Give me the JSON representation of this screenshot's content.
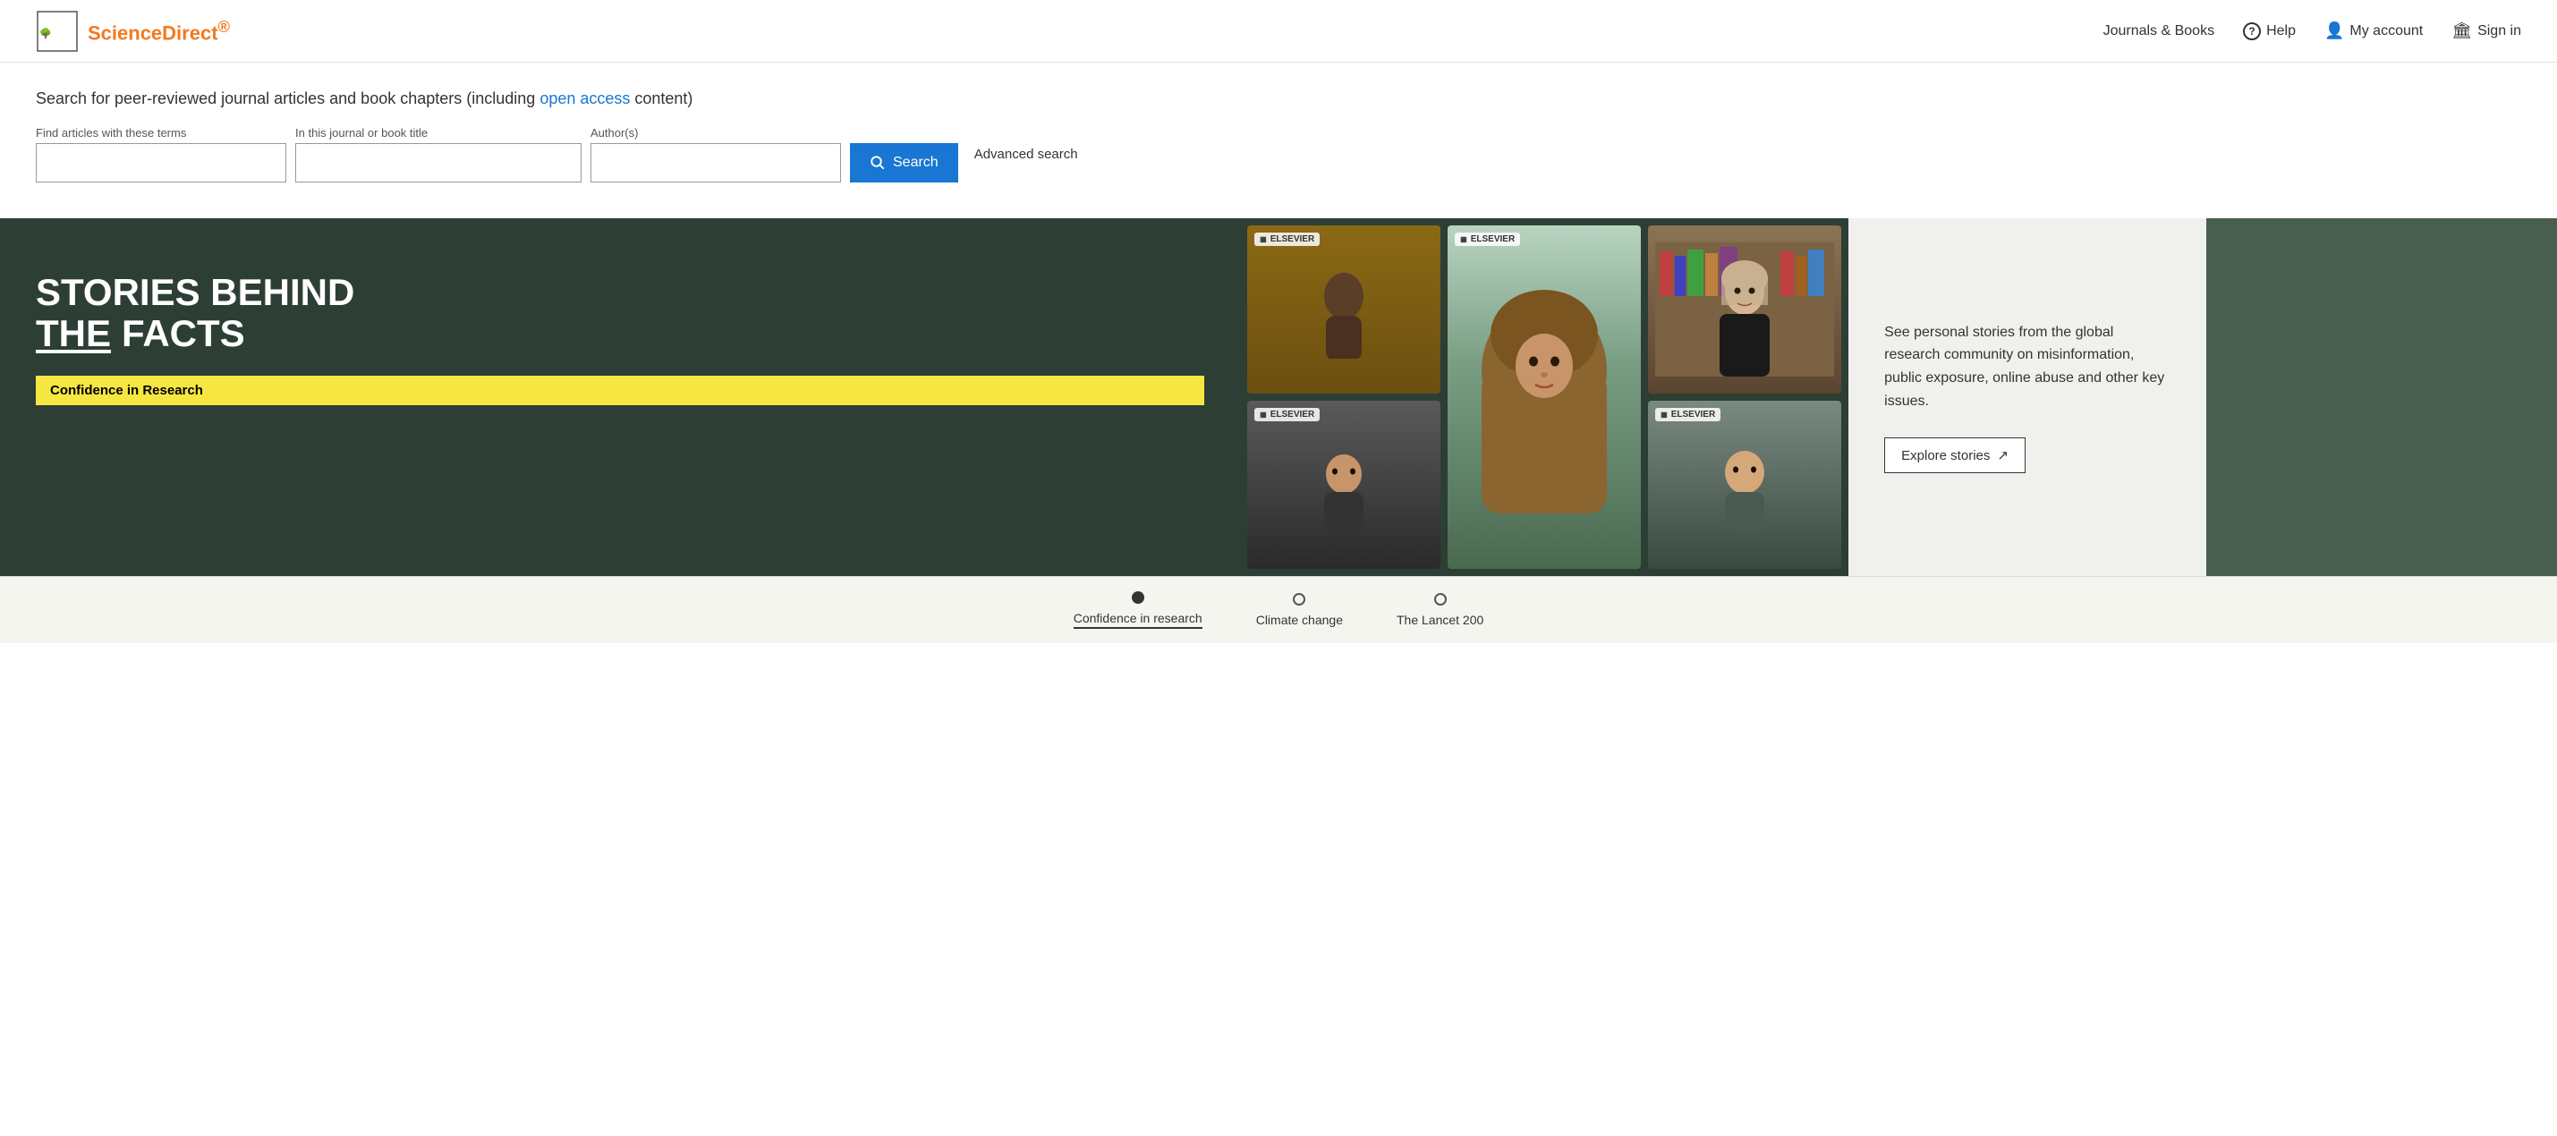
{
  "header": {
    "logo_alt": "Elsevier",
    "logo_text": "ScienceDirect",
    "logo_registered": "®",
    "nav": {
      "journals_books": "Journals & Books",
      "help": "Help",
      "my_account": "My account",
      "sign_in": "Sign in"
    }
  },
  "search": {
    "headline_before": "Search for peer-reviewed journal articles and book chapters (including ",
    "headline_link": "open access",
    "headline_after": " content)",
    "field1_label": "Find articles with these terms",
    "field1_placeholder": "",
    "field2_label": "In this journal or book title",
    "field2_placeholder": "",
    "field3_label": "Author(s)",
    "field3_placeholder": "",
    "search_button": "Search",
    "advanced_search": "Advanced search"
  },
  "hero": {
    "title_line1": "STORIES BEHIND",
    "title_line2_pre": "THE",
    "title_line2_main": "FACTS",
    "badge_label": "Confidence in Research",
    "right_text": "See personal stories from the global research community on misinformation, public exposure, online abuse and other key issues.",
    "explore_button": "Explore stories",
    "explore_icon": "↗"
  },
  "carousel": {
    "items": [
      {
        "label": "Confidence in research",
        "active": true
      },
      {
        "label": "Climate change",
        "active": false
      },
      {
        "label": "The Lancet 200",
        "active": false
      }
    ]
  },
  "images": [
    {
      "id": "img1",
      "alt": "Person 1",
      "elsevier_badge": "ELSEVIER"
    },
    {
      "id": "img2",
      "alt": "Person in hijab - large",
      "elsevier_badge": "ELSEVIER"
    },
    {
      "id": "img3",
      "alt": "Woman in front of bookshelf",
      "elsevier_badge": ""
    },
    {
      "id": "img4",
      "alt": "Person 4",
      "elsevier_badge": "ELSEVIER"
    },
    {
      "id": "img5",
      "alt": "Person 5",
      "elsevier_badge": "ELSEVIER"
    }
  ]
}
